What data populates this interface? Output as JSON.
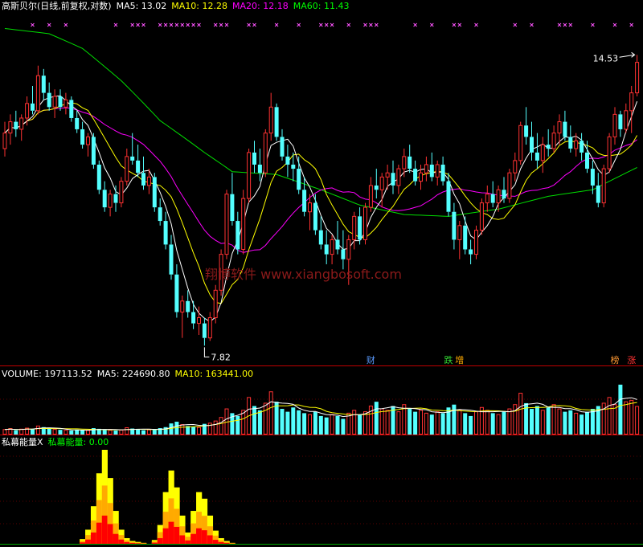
{
  "header": {
    "title": "高斯贝尔(日线,前复权,对数)",
    "ma5": "MA5: 13.02",
    "ma10": "MA10: 12.28",
    "ma20": "MA20: 12.18",
    "ma60": "MA60: 11.43"
  },
  "volume_header": {
    "label": "VOLUME: 197113.52",
    "ma5": "MA5: 224690.80",
    "ma10": "MA10: 163441.00"
  },
  "indicator_header": {
    "name": "私幕能量X",
    "value": "私幕能量: 0.00"
  },
  "annotations": {
    "high_label": "14.53",
    "high_index": 114,
    "low_label": "7.82",
    "low_index": 36
  },
  "watermark": "翔博软件 www.xiangbosoft.com",
  "event_markers": [
    {
      "label": "财",
      "index": 66,
      "color": "#5a9bff"
    },
    {
      "label": "跌",
      "index": 80,
      "color": "#33dd33"
    },
    {
      "label": "增",
      "index": 82,
      "color": "#ffaa00"
    },
    {
      "label": "榜",
      "index": 110,
      "color": "#ff9933"
    },
    {
      "label": "涨",
      "index": 113,
      "color": "#ff3333"
    }
  ],
  "colors": {
    "up": "#ff3232",
    "down": "#54ffff",
    "ma5": "#ffffff",
    "ma10": "#ffff00",
    "ma20": "#ff00ff",
    "ma60": "#00dd00",
    "signal_marker": "#ff55ff",
    "separator": "#c00000",
    "indicator_outer": "#ffff00",
    "indicator_mid": "#ffaa00",
    "indicator_inner": "#ff0000",
    "watermark": "#8b1a1a"
  },
  "chart_data": {
    "type": "candlestick",
    "y_scale": "log",
    "ylim": [
      7.6,
      16.5
    ],
    "ohlc": [
      [
        11.9,
        12.6,
        11.7,
        12.3
      ],
      [
        12.3,
        12.8,
        12.0,
        12.6
      ],
      [
        12.6,
        12.9,
        12.2,
        12.4
      ],
      [
        12.4,
        12.8,
        12.1,
        12.7
      ],
      [
        12.7,
        13.3,
        12.5,
        13.1
      ],
      [
        13.1,
        13.6,
        12.8,
        12.9
      ],
      [
        12.9,
        14.2,
        12.8,
        13.9
      ],
      [
        13.9,
        14.1,
        13.2,
        13.4
      ],
      [
        13.4,
        13.7,
        12.9,
        13.0
      ],
      [
        13.0,
        13.5,
        12.7,
        13.3
      ],
      [
        13.3,
        13.5,
        12.9,
        13.0
      ],
      [
        13.0,
        13.4,
        12.8,
        13.2
      ],
      [
        13.2,
        13.3,
        12.6,
        12.7
      ],
      [
        12.7,
        12.9,
        12.3,
        12.4
      ],
      [
        12.4,
        12.6,
        11.9,
        12.0
      ],
      [
        12.0,
        12.3,
        11.7,
        12.2
      ],
      [
        12.2,
        12.3,
        11.4,
        11.5
      ],
      [
        11.5,
        11.6,
        10.8,
        10.9
      ],
      [
        10.9,
        11.1,
        10.4,
        10.5
      ],
      [
        10.5,
        10.9,
        10.3,
        10.8
      ],
      [
        10.8,
        11.0,
        10.4,
        10.6
      ],
      [
        10.6,
        11.2,
        10.5,
        11.1
      ],
      [
        11.1,
        11.9,
        11.0,
        11.7
      ],
      [
        11.7,
        12.3,
        11.5,
        11.6
      ],
      [
        11.6,
        12.0,
        11.2,
        11.3
      ],
      [
        11.3,
        11.7,
        10.9,
        11.0
      ],
      [
        11.0,
        11.4,
        10.8,
        11.2
      ],
      [
        11.2,
        11.3,
        10.4,
        10.5
      ],
      [
        10.5,
        10.7,
        10.1,
        10.2
      ],
      [
        10.2,
        10.4,
        9.6,
        9.7
      ],
      [
        9.7,
        9.9,
        9.0,
        9.1
      ],
      [
        9.1,
        9.3,
        8.3,
        8.4
      ],
      [
        8.4,
        8.7,
        7.95,
        8.6
      ],
      [
        8.6,
        8.8,
        8.3,
        8.4
      ],
      [
        8.4,
        8.6,
        8.1,
        8.2
      ],
      [
        8.2,
        8.5,
        8.0,
        8.3
      ],
      [
        8.2,
        8.3,
        7.82,
        7.95
      ],
      [
        7.95,
        8.4,
        7.9,
        8.3
      ],
      [
        8.3,
        8.9,
        8.2,
        8.8
      ],
      [
        8.8,
        9.6,
        8.7,
        9.5
      ],
      [
        9.5,
        10.9,
        9.4,
        10.8
      ],
      [
        10.8,
        11.3,
        10.1,
        10.2
      ],
      [
        10.2,
        10.4,
        9.5,
        9.6
      ],
      [
        9.6,
        10.9,
        9.5,
        10.7
      ],
      [
        10.7,
        11.9,
        10.6,
        11.8
      ],
      [
        11.8,
        12.1,
        11.3,
        11.5
      ],
      [
        11.5,
        11.9,
        11.1,
        11.3
      ],
      [
        11.3,
        12.4,
        11.2,
        12.3
      ],
      [
        12.3,
        13.4,
        12.1,
        13.0
      ],
      [
        13.0,
        13.1,
        12.1,
        12.2
      ],
      [
        12.2,
        12.4,
        11.6,
        11.7
      ],
      [
        11.7,
        12.0,
        11.2,
        11.5
      ],
      [
        11.5,
        11.8,
        11.1,
        11.4
      ],
      [
        11.4,
        11.7,
        10.8,
        10.9
      ],
      [
        10.9,
        11.2,
        10.3,
        10.4
      ],
      [
        10.4,
        10.8,
        10.0,
        10.6
      ],
      [
        10.6,
        10.8,
        9.9,
        10.0
      ],
      [
        10.0,
        10.3,
        9.6,
        9.7
      ],
      [
        9.7,
        10.0,
        9.3,
        9.5
      ],
      [
        9.5,
        9.9,
        9.3,
        9.8
      ],
      [
        9.8,
        10.2,
        9.5,
        9.6
      ],
      [
        9.6,
        10.0,
        9.2,
        9.4
      ],
      [
        9.4,
        9.9,
        8.9,
        9.8
      ],
      [
        9.8,
        10.4,
        9.6,
        10.3
      ],
      [
        10.3,
        10.5,
        9.7,
        9.8
      ],
      [
        9.8,
        10.6,
        9.7,
        10.5
      ],
      [
        10.5,
        11.2,
        10.4,
        11.0
      ],
      [
        11.0,
        11.4,
        10.7,
        10.9
      ],
      [
        10.9,
        11.3,
        10.5,
        11.2
      ],
      [
        11.2,
        11.5,
        10.9,
        11.3
      ],
      [
        11.3,
        11.6,
        10.8,
        11.0
      ],
      [
        11.0,
        11.5,
        10.8,
        11.4
      ],
      [
        11.4,
        11.9,
        11.2,
        11.7
      ],
      [
        11.7,
        12.0,
        11.3,
        11.4
      ],
      [
        11.4,
        11.6,
        11.0,
        11.1
      ],
      [
        11.1,
        11.5,
        10.9,
        11.3
      ],
      [
        11.3,
        11.7,
        11.1,
        11.5
      ],
      [
        11.5,
        11.8,
        11.1,
        11.2
      ],
      [
        11.2,
        11.6,
        11.0,
        11.5
      ],
      [
        11.5,
        11.7,
        11.0,
        11.1
      ],
      [
        11.1,
        11.3,
        10.3,
        10.4
      ],
      [
        10.4,
        10.6,
        9.6,
        9.8
      ],
      [
        9.8,
        10.2,
        9.4,
        10.1
      ],
      [
        10.1,
        10.3,
        9.5,
        9.6
      ],
      [
        9.6,
        9.8,
        9.3,
        9.5
      ],
      [
        9.5,
        10.1,
        9.4,
        10.0
      ],
      [
        10.0,
        10.7,
        9.9,
        10.6
      ],
      [
        10.6,
        11.0,
        10.4,
        10.8
      ],
      [
        10.8,
        11.1,
        10.5,
        10.6
      ],
      [
        10.6,
        11.0,
        10.4,
        10.9
      ],
      [
        10.9,
        11.2,
        10.6,
        10.7
      ],
      [
        10.7,
        11.4,
        10.6,
        11.3
      ],
      [
        11.3,
        11.8,
        11.1,
        11.6
      ],
      [
        11.6,
        12.6,
        11.5,
        12.5
      ],
      [
        12.5,
        13.0,
        12.0,
        12.2
      ],
      [
        12.2,
        12.6,
        11.6,
        11.8
      ],
      [
        11.8,
        12.3,
        11.4,
        11.6
      ],
      [
        11.6,
        12.2,
        11.3,
        12.0
      ],
      [
        12.0,
        12.4,
        11.7,
        11.9
      ],
      [
        11.9,
        12.5,
        11.8,
        12.3
      ],
      [
        12.3,
        12.8,
        12.0,
        12.6
      ],
      [
        12.6,
        12.9,
        12.1,
        12.2
      ],
      [
        12.2,
        12.5,
        11.8,
        11.9
      ],
      [
        11.9,
        12.3,
        11.7,
        12.1
      ],
      [
        12.1,
        12.3,
        11.6,
        11.8
      ],
      [
        11.8,
        12.1,
        11.3,
        11.4
      ],
      [
        11.4,
        11.6,
        10.8,
        11.0
      ],
      [
        11.0,
        11.3,
        10.5,
        10.6
      ],
      [
        10.6,
        11.5,
        10.5,
        11.4
      ],
      [
        11.4,
        12.3,
        11.3,
        12.2
      ],
      [
        12.2,
        13.0,
        12.0,
        12.8
      ],
      [
        12.8,
        12.9,
        12.2,
        12.4
      ],
      [
        12.4,
        13.1,
        12.3,
        12.9
      ],
      [
        12.9,
        13.6,
        12.3,
        13.4
      ],
      [
        13.4,
        14.53,
        13.3,
        14.3
      ]
    ],
    "ma60_line": [
      [
        0,
        15.37
      ],
      [
        8,
        15.2
      ],
      [
        14,
        14.73
      ],
      [
        21,
        13.75
      ],
      [
        28,
        12.63
      ],
      [
        36,
        11.8
      ],
      [
        41,
        11.33
      ],
      [
        49,
        11.26
      ],
      [
        57,
        10.9
      ],
      [
        64,
        10.55
      ],
      [
        72,
        10.34
      ],
      [
        80,
        10.3
      ],
      [
        89,
        10.46
      ],
      [
        98,
        10.75
      ],
      [
        106,
        10.9
      ],
      [
        114,
        11.43
      ]
    ],
    "signal_marker_indices": [
      5,
      8,
      11,
      20,
      23,
      24,
      25,
      28,
      29,
      30,
      31,
      32,
      33,
      34,
      35,
      38,
      39,
      40,
      44,
      45,
      49,
      53,
      57,
      58,
      59,
      62,
      65,
      66,
      67,
      74,
      77,
      81,
      82,
      85,
      92,
      95,
      100,
      101,
      102,
      106,
      110,
      113
    ],
    "volume": {
      "ylim": [
        0,
        400000
      ],
      "values": [
        35000,
        42000,
        30000,
        38000,
        45000,
        40000,
        60000,
        52000,
        40000,
        36000,
        33000,
        30000,
        28000,
        34000,
        31000,
        29000,
        45000,
        40000,
        35000,
        30000,
        28000,
        32000,
        48000,
        42000,
        36000,
        30000,
        33000,
        38000,
        45000,
        52000,
        78000,
        90000,
        70000,
        60000,
        55000,
        50000,
        75000,
        80000,
        95000,
        120000,
        180000,
        150000,
        130000,
        170000,
        260000,
        200000,
        170000,
        220000,
        300000,
        230000,
        180000,
        160000,
        190000,
        170000,
        150000,
        140000,
        160000,
        130000,
        120000,
        140000,
        130000,
        110000,
        150000,
        170000,
        140000,
        160000,
        200000,
        230000,
        180000,
        170000,
        200000,
        160000,
        210000,
        180000,
        160000,
        170000,
        150000,
        140000,
        160000,
        150000,
        190000,
        210000,
        170000,
        150000,
        130000,
        160000,
        190000,
        170000,
        150000,
        140000,
        160000,
        180000,
        210000,
        290000,
        220000,
        180000,
        200000,
        170000,
        190000,
        210000,
        180000,
        160000,
        170000,
        150000,
        140000,
        160000,
        180000,
        200000,
        220000,
        260000,
        210000,
        350000,
        230000,
        240000,
        197113.52
      ]
    },
    "indicator": {
      "ylim": [
        0,
        100
      ],
      "values": [
        0,
        0,
        0,
        0,
        0,
        0,
        0,
        0,
        0,
        0,
        0,
        0,
        0,
        0,
        5,
        15,
        40,
        75,
        100,
        70,
        35,
        15,
        6,
        3,
        2,
        1,
        0,
        4,
        20,
        55,
        78,
        60,
        30,
        12,
        35,
        55,
        48,
        30,
        14,
        6,
        3,
        1,
        0,
        0,
        0,
        0,
        0,
        0,
        0,
        0,
        0,
        0,
        0,
        0,
        0,
        0,
        0,
        0,
        0,
        0,
        0,
        0,
        0,
        0,
        0,
        0,
        0,
        0,
        0,
        0,
        0,
        0,
        0,
        0,
        0,
        0,
        0,
        0,
        0,
        0,
        0,
        0,
        0,
        0,
        0,
        0,
        0,
        0,
        0,
        0,
        0,
        0,
        0,
        0,
        0,
        0,
        0,
        0,
        0,
        0,
        0,
        0,
        0,
        0,
        0,
        0,
        0,
        0,
        0,
        0,
        0,
        0,
        0,
        0,
        0
      ]
    }
  }
}
